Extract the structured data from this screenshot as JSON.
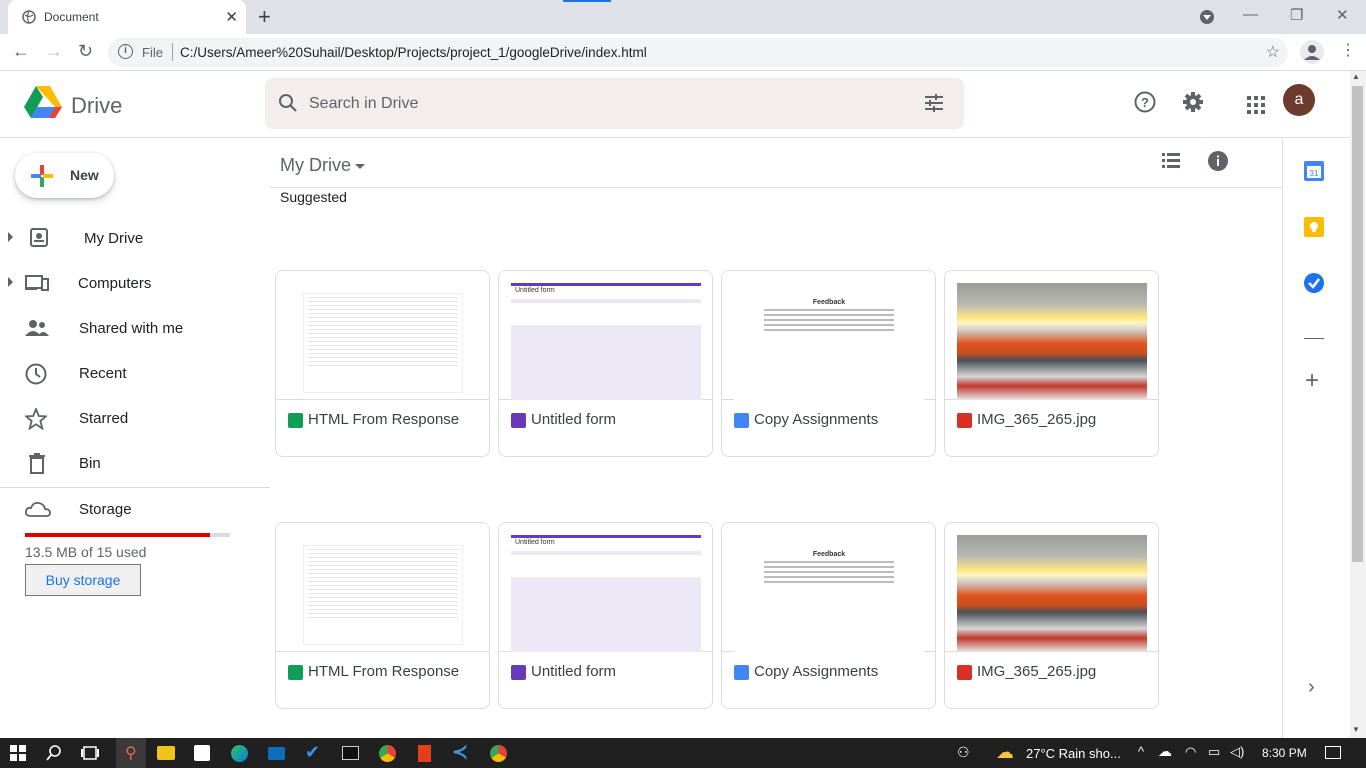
{
  "browser": {
    "tab_title": "Document",
    "url_scheme": "File",
    "url": "C:/Users/Ameer%20Suhail/Desktop/Projects/project_1/googleDrive/index.html"
  },
  "drive": {
    "brand": "Drive",
    "search_placeholder": "Search in Drive",
    "avatar_letter": "a",
    "new_label": "New"
  },
  "sidebar": {
    "items": [
      {
        "label": "My Drive",
        "icon": "drive-icon"
      },
      {
        "label": "Computers",
        "icon": "computer-icon"
      },
      {
        "label": "Shared with me",
        "icon": "people-icon"
      },
      {
        "label": "Recent",
        "icon": "clock-icon"
      },
      {
        "label": "Starred",
        "icon": "star-icon"
      },
      {
        "label": "Bin",
        "icon": "trash-icon"
      }
    ],
    "storage_label": "Storage",
    "usage": "13.5 MB of 15 used",
    "usage_fraction": 0.9,
    "buy_label": "Buy storage"
  },
  "main": {
    "breadcrumb": "My Drive",
    "section": "Suggested",
    "rows": [
      [
        {
          "name": "HTML From Response",
          "type": "sheet"
        },
        {
          "name": "Untitled form",
          "type": "form"
        },
        {
          "name": "Copy Assignments",
          "type": "doc"
        },
        {
          "name": "IMG_365_265.jpg",
          "type": "image"
        }
      ],
      [
        {
          "name": "HTML From Response",
          "type": "sheet"
        },
        {
          "name": "Untitled form",
          "type": "form"
        },
        {
          "name": "Copy Assignments",
          "type": "doc"
        },
        {
          "name": "IMG_365_265.jpg",
          "type": "image"
        }
      ]
    ],
    "form_thumb_title": "Untitled form",
    "doc_thumb_title": "Feedback"
  },
  "colors": {
    "sheet": "#0f9d58",
    "form": "#673ab7",
    "doc": "#4285f4",
    "image": "#d93025",
    "storage_bar": "#e00000"
  },
  "taskbar": {
    "weather": "27°C  Rain sho...",
    "time": "8:30 PM"
  }
}
